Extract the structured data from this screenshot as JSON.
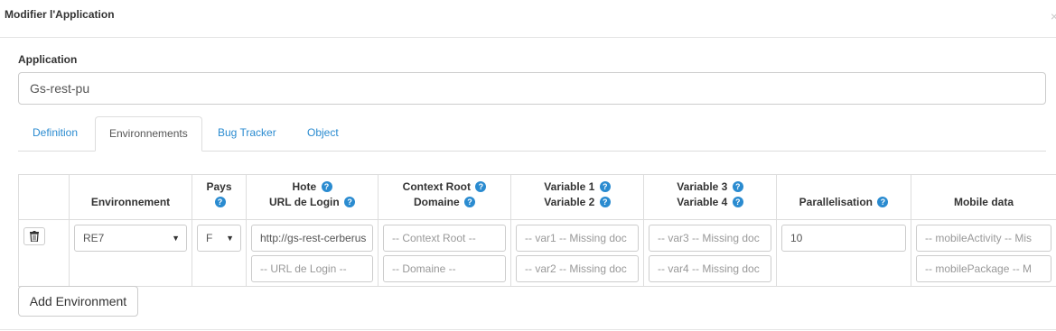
{
  "modal": {
    "title": "Modifier l'Application",
    "close": "×"
  },
  "application": {
    "label": "Application",
    "value": "Gs-rest-pu"
  },
  "tabs": [
    "Definition",
    "Environnements",
    "Bug Tracker",
    "Object"
  ],
  "table": {
    "headers": {
      "environnement": "Environnement",
      "pays": "Pays",
      "hote": "Hote",
      "url_login": "URL de Login",
      "context_root": "Context Root",
      "domaine": "Domaine",
      "var1": "Variable 1",
      "var2": "Variable 2",
      "var3": "Variable 3",
      "var4": "Variable 4",
      "parallelisation": "Parallelisation",
      "mobile": "Mobile data"
    },
    "row": {
      "environnement": "RE7",
      "pays": "F",
      "hote": "http://gs-rest-cerberus",
      "url_login_placeholder": "-- URL de Login --",
      "context_root_placeholder": "-- Context Root --",
      "domaine_placeholder": "-- Domaine --",
      "var1_placeholder": "-- var1 -- Missing doc",
      "var2_placeholder": "-- var2 -- Missing doc",
      "var3_placeholder": "-- var3 -- Missing doc",
      "var4_placeholder": "-- var4 -- Missing doc",
      "parallelisation": "10",
      "mobile_activity_placeholder": "-- mobileActivity -- Mis",
      "mobile_package_placeholder": "-- mobilePackage -- M"
    }
  },
  "add_button": "Add Environment",
  "icons": {
    "help": "question-circle-icon",
    "delete": "trash-icon",
    "caret": "caret-down-icon"
  },
  "colors": {
    "link": "#2a8bd0",
    "border": "#dddddd"
  }
}
